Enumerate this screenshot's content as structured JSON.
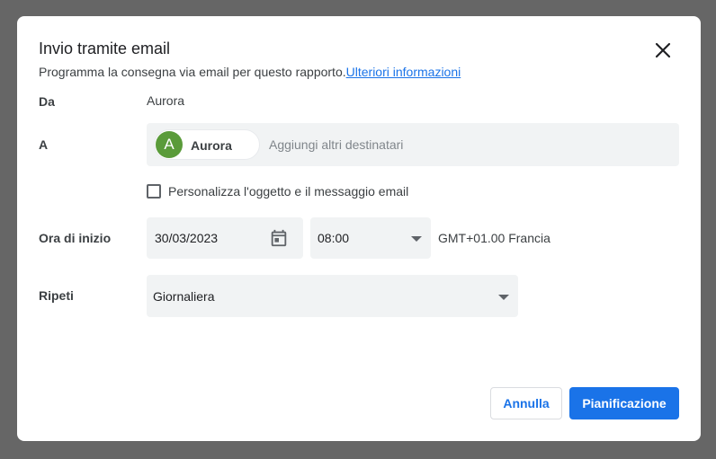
{
  "dialog": {
    "title": "Invio tramite email",
    "subtitle": "Programma la consegna via email per questo rapporto.",
    "link": "Ulteriori informazioni",
    "close_icon": "close-icon"
  },
  "from": {
    "label": "Da",
    "value": "Aurora"
  },
  "to": {
    "label": "A",
    "chip": {
      "initial": "A",
      "name": "Aurora",
      "avatar_color": "#5a9b3a"
    },
    "placeholder": "Aggiungi altri destinatari"
  },
  "customize": {
    "label": "Personalizza l'oggetto e il messaggio email",
    "checked": false
  },
  "start": {
    "label": "Ora di inizio",
    "date": "30/03/2023",
    "calendar_icon": "calendar-icon",
    "time": "08:00",
    "timezone": "GMT+01.00 Francia"
  },
  "repeat": {
    "label": "Ripeti",
    "value": "Giornaliera"
  },
  "buttons": {
    "cancel": "Annulla",
    "submit": "Pianificazione"
  },
  "colors": {
    "accent": "#1a73e8",
    "backdrop": "#666666",
    "field_bg": "#f1f3f4"
  }
}
